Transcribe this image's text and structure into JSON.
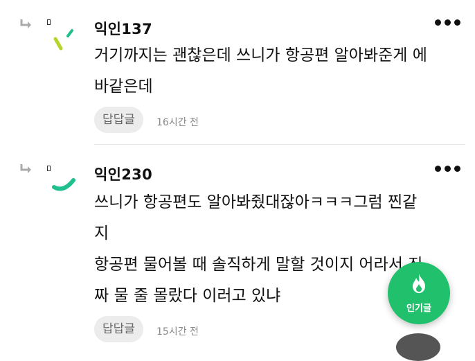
{
  "comments": [
    {
      "username": "익인137",
      "text_lines": [
        "거기까지는 괜찮은데 쓰니가 항공편 알아봐준게 에",
        "바같은데"
      ],
      "reply_label": "답답글",
      "time": "16시간 전",
      "avatar_color": "#b5d42a"
    },
    {
      "username": "익인230",
      "text_lines": [
        "쓰니가 항공편도 알아봐줬대잖아ㅋㅋㅋ그럼 찐같",
        "지",
        "항공편 물어볼 때 솔직하게 말할 것이지 어라서 진",
        "짜 물 줄 몰랐다 이러고 있냐"
      ],
      "reply_label": "답답글",
      "time": "15시간 전",
      "avatar_color": "#1fbf8e"
    }
  ],
  "fab": {
    "label": "인기글",
    "icon": "flame-icon",
    "color": "#20c06c"
  },
  "icons": {
    "reply": "reply-arrow-icon",
    "more": "more-dots-icon"
  }
}
